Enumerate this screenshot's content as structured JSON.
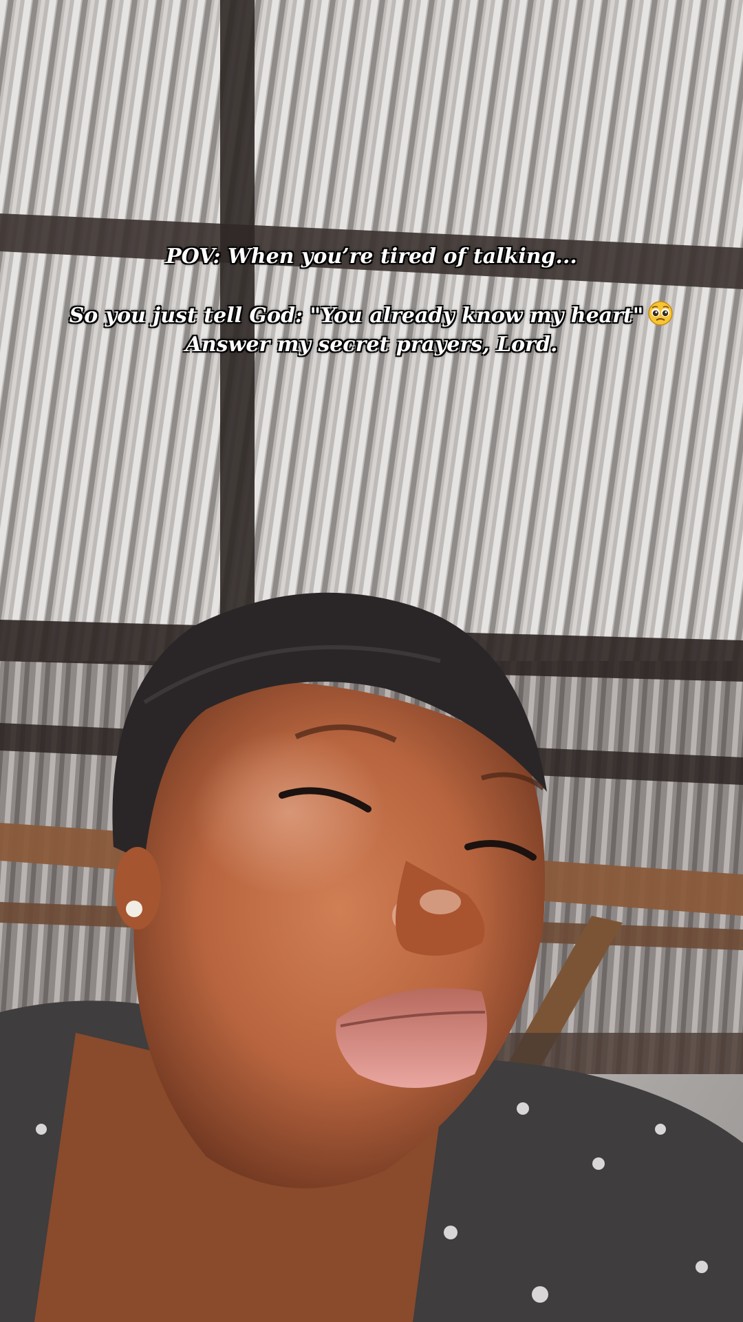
{
  "caption": {
    "line1": "POV: When you’re tired of talking...",
    "line2": "So you just tell God: \"You already know my heart\"",
    "line2_emoji": "pleading-face-emoji",
    "line3": "Answer my secret prayers, Lord."
  }
}
